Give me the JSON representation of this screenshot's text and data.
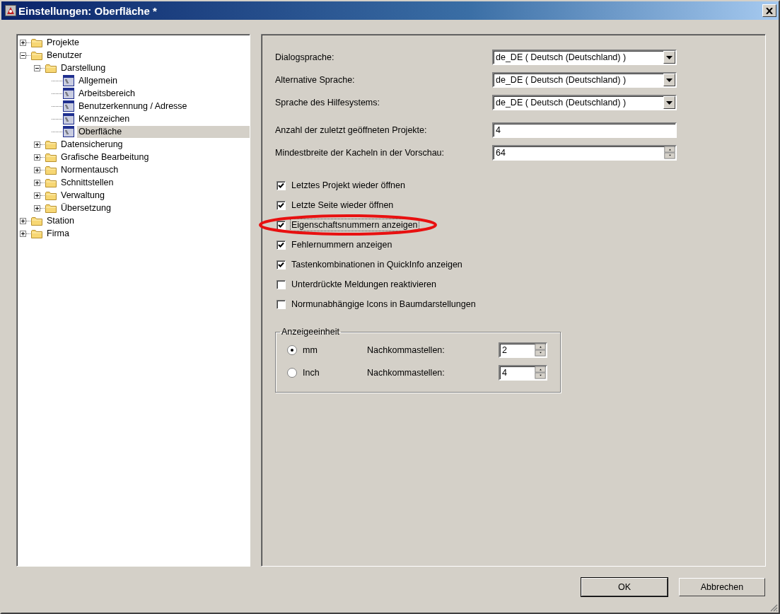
{
  "window": {
    "title": "Einstellungen: Oberfläche *"
  },
  "tree": [
    {
      "label": "Projekte",
      "kind": "folder",
      "expanded": false,
      "selected": false
    },
    {
      "label": "Benutzer",
      "kind": "folder",
      "expanded": true,
      "selected": false,
      "children": [
        {
          "label": "Darstellung",
          "kind": "folder",
          "expanded": true,
          "selected": false,
          "children": [
            {
              "label": "Allgemein",
              "kind": "page",
              "selected": false
            },
            {
              "label": "Arbeitsbereich",
              "kind": "page",
              "selected": false
            },
            {
              "label": "Benutzerkennung / Adresse",
              "kind": "page",
              "selected": false
            },
            {
              "label": "Kennzeichen",
              "kind": "page",
              "selected": false
            },
            {
              "label": "Oberfläche",
              "kind": "page",
              "selected": true
            }
          ]
        },
        {
          "label": "Datensicherung",
          "kind": "folder",
          "expanded": false,
          "selected": false
        },
        {
          "label": "Grafische Bearbeitung",
          "kind": "folder",
          "expanded": false,
          "selected": false
        },
        {
          "label": "Normentausch",
          "kind": "folder",
          "expanded": false,
          "selected": false
        },
        {
          "label": "Schnittstellen",
          "kind": "folder",
          "expanded": false,
          "selected": false
        },
        {
          "label": "Verwaltung",
          "kind": "folder",
          "expanded": false,
          "selected": false
        },
        {
          "label": "Übersetzung",
          "kind": "folder",
          "expanded": false,
          "selected": false
        }
      ]
    },
    {
      "label": "Station",
      "kind": "folder",
      "expanded": false,
      "selected": false
    },
    {
      "label": "Firma",
      "kind": "folder",
      "expanded": false,
      "selected": false
    }
  ],
  "language_fields": [
    {
      "kind": "combo",
      "label": "Dialogsprache:",
      "value": "de_DE ( Deutsch (Deutschland) )"
    },
    {
      "kind": "combo",
      "label": "Alternative Sprache:",
      "value": "de_DE ( Deutsch (Deutschland) )"
    },
    {
      "kind": "combo",
      "label": "Sprache des Hilfesystems:",
      "value": "de_DE ( Deutsch (Deutschland) )"
    }
  ],
  "number_fields": [
    {
      "kind": "text",
      "label": "Anzahl der zuletzt geöffneten Projekte:",
      "value": "4"
    },
    {
      "kind": "spin",
      "label": "Mindestbreite der Kacheln in der Vorschau:",
      "value": "64"
    }
  ],
  "checkboxes": [
    {
      "label": "Letztes Projekt wieder öffnen",
      "checked": true,
      "focused": false,
      "highlighted": false
    },
    {
      "label": "Letzte Seite wieder öffnen",
      "checked": true,
      "focused": false,
      "highlighted": false
    },
    {
      "label": "Eigenschaftsnummern anzeigen",
      "checked": true,
      "focused": true,
      "highlighted": true
    },
    {
      "label": "Fehlernummern anzeigen",
      "checked": true,
      "focused": false,
      "highlighted": false
    },
    {
      "label": "Tastenkombinationen in QuickInfo anzeigen",
      "checked": true,
      "focused": false,
      "highlighted": false
    },
    {
      "label": "Unterdrückte Meldungen reaktivieren",
      "checked": false,
      "focused": false,
      "highlighted": false
    },
    {
      "label": "Normunabhängige Icons in Baumdarstellungen",
      "checked": false,
      "focused": false,
      "highlighted": false
    }
  ],
  "unit_group": {
    "title": "Anzeigeeinheit",
    "options": [
      {
        "label": "mm",
        "selected": true,
        "decimals_label": "Nachkommastellen:",
        "decimals": "2"
      },
      {
        "label": "Inch",
        "selected": false,
        "decimals_label": "Nachkommastellen:",
        "decimals": "4"
      }
    ]
  },
  "buttons": [
    {
      "label": "OK",
      "default": true
    },
    {
      "label": "Abbrechen",
      "default": false
    }
  ]
}
